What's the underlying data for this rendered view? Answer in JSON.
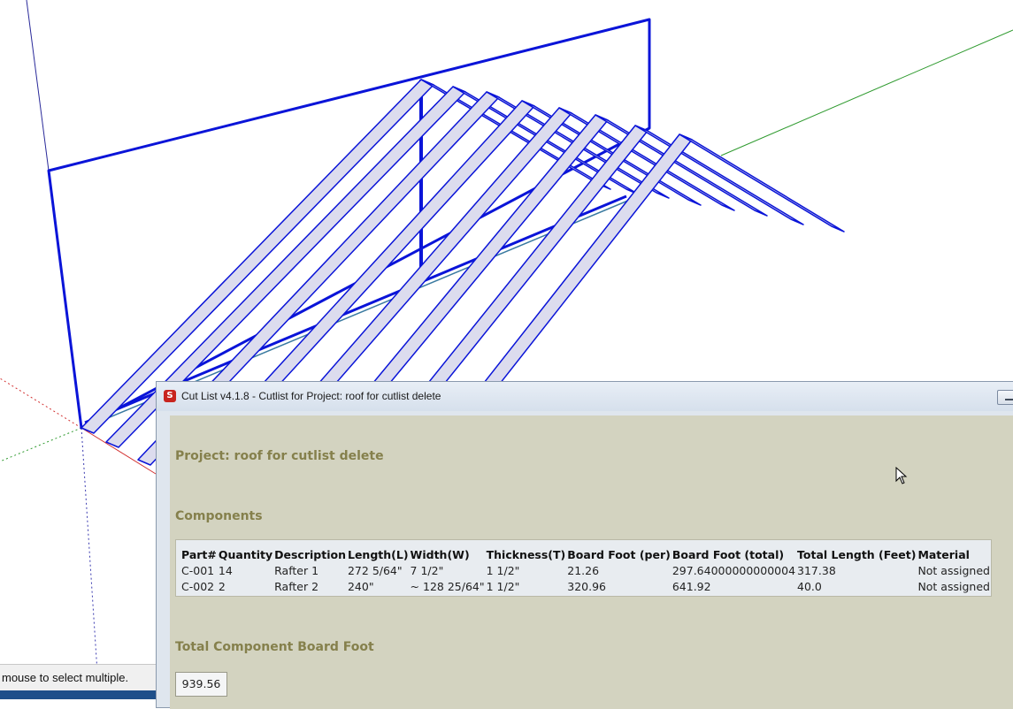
{
  "status_bar": {
    "text": "mouse to select multiple."
  },
  "window": {
    "title": "Cut List v4.1.8 -  Cutlist for Project: roof for cutlist delete",
    "app_icon_glyph": "S"
  },
  "report": {
    "project_heading": "Project: roof for cutlist delete",
    "components_heading": "Components",
    "table": {
      "columns": [
        "Part#",
        "Quantity",
        "Description",
        "Length(L)",
        "Width(W)",
        "Thickness(T)",
        "Board Foot (per)",
        "Board Foot (total)",
        "Total Length (Feet)",
        "Material"
      ],
      "rows": [
        [
          "C-001",
          "14",
          "Rafter 1",
          "272 5/64\"",
          "7 1/2\"",
          "1 1/2\"",
          "21.26",
          "297.64000000000004",
          "317.38",
          "Not assigned"
        ],
        [
          "C-002",
          "2",
          "Rafter 2",
          "240\"",
          "~ 128 25/64\"",
          "1 1/2\"",
          "320.96",
          "641.92",
          "40.0",
          "Not assigned"
        ]
      ]
    },
    "total_heading": "Total Component Board Foot",
    "total_value": "939.56"
  },
  "colors": {
    "heading_olive": "#85804c",
    "report_background": "#d3d3c0",
    "model_edge_blue": "#0a14d8",
    "rafter_face": "#dcdcee",
    "green_axis": "#2e9a2e",
    "red_axis": "#d23030"
  },
  "icons": {
    "app_icon": "sketchup-icon",
    "minimize": "minimize-icon",
    "cursor": "arrow-cursor-icon"
  }
}
